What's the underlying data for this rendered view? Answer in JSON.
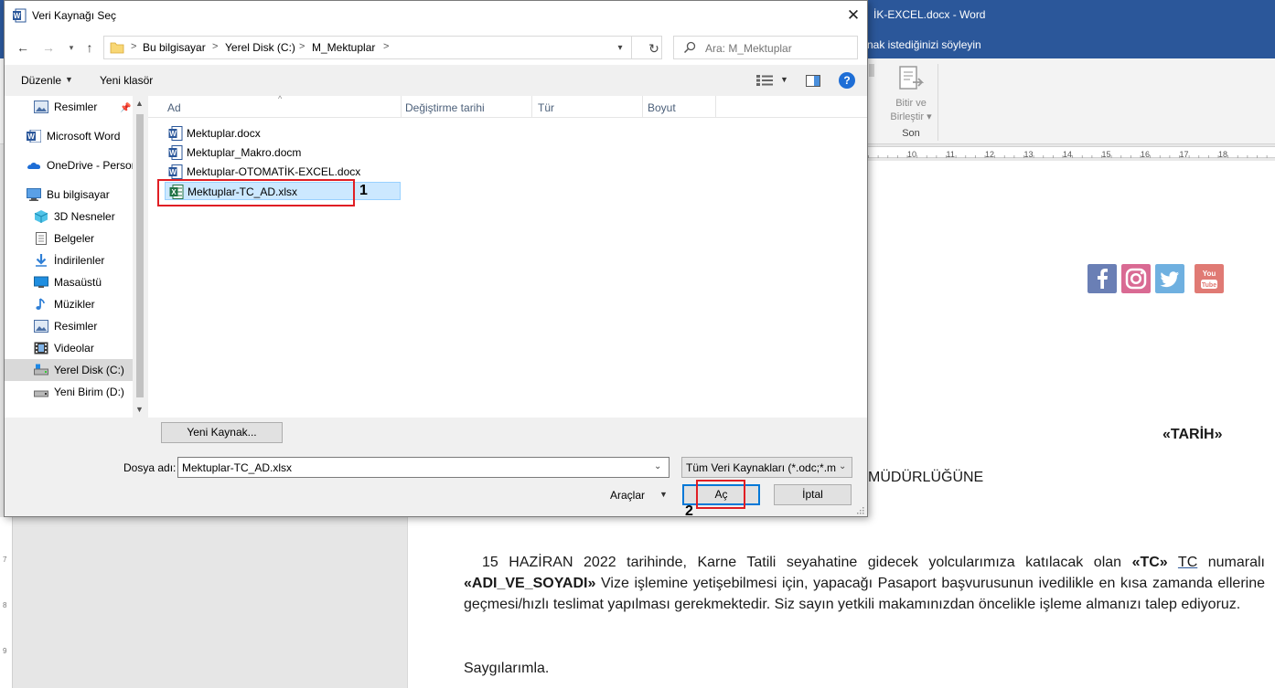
{
  "word": {
    "title": "İK-EXCEL.docx  -  Word",
    "tell_me": "nak istediğinizi söyleyin",
    "ribbon": {
      "finish_merge_label": "Bitir ve\nBirleştir ▾",
      "group_label": "Son"
    },
    "ruler_numbers": [
      "10",
      "11",
      "12",
      "13",
      "14",
      "15",
      "16",
      "17",
      "18"
    ],
    "vruler_numbers": [
      "7",
      "8",
      "9"
    ],
    "document": {
      "tarih": "«TARİH»",
      "mudurluk": "MÜDÜRLÜĞÜNE",
      "paragraph": {
        "p1": "15 HAZİRAN 2022 tarihinde, Karne Tatili seyahatine gidecek yolcularımıza katılacak olan ",
        "tc_field": "«TC»",
        "p2": " ",
        "tc_word": "TC",
        "p3": " numaralı ",
        "name_field": "«ADI_VE_SOYADI»",
        "p4": " Vize işlemine yetişebilmesi için, yapacağı Pasaport başvurusunun ivedilikle en kısa zamanda ellerine geçmesi/hızlı teslimat yapılması gerekmektedir. Siz sayın yetkili makamınızdan öncelikle işleme almanızı talep ediyoruz."
      },
      "closing": "Saygılarımla.",
      "social_icons": [
        "facebook-icon",
        "instagram-icon",
        "twitter-icon",
        "youtube-icon"
      ]
    }
  },
  "dialog": {
    "title": "Veri Kaynağı Seç",
    "close_glyph": "✕",
    "address": {
      "segments": [
        "Bu bilgisayar",
        "Yerel Disk (C:)",
        "M_Mektuplar"
      ],
      "separator": ">"
    },
    "search": {
      "placeholder": "Ara: M_Mektuplar"
    },
    "toolbar": {
      "organize": "Düzenle",
      "new_folder": "Yeni klasör",
      "help": "?"
    },
    "nav_items": [
      {
        "label": "Resimler",
        "icon": "pictures-icon"
      },
      {
        "label": "Microsoft Word",
        "icon": "word-icon"
      },
      {
        "label": "OneDrive - Person",
        "icon": "onedrive-icon"
      },
      {
        "label": "Bu bilgisayar",
        "icon": "computer-icon"
      },
      {
        "label": "3D Nesneler",
        "icon": "3d-objects-icon"
      },
      {
        "label": "Belgeler",
        "icon": "documents-icon"
      },
      {
        "label": "İndirilenler",
        "icon": "downloads-icon"
      },
      {
        "label": "Masaüstü",
        "icon": "desktop-icon"
      },
      {
        "label": "Müzikler",
        "icon": "music-icon"
      },
      {
        "label": "Resimler",
        "icon": "pictures-icon"
      },
      {
        "label": "Videolar",
        "icon": "videos-icon"
      },
      {
        "label": "Yerel Disk (C:)",
        "icon": "local-disk-icon",
        "selected": true
      },
      {
        "label": "Yeni Birim (D:)",
        "icon": "drive-icon"
      }
    ],
    "columns": [
      "Ad",
      "Değiştirme tarihi",
      "Tür",
      "Boyut"
    ],
    "files": [
      {
        "name": "Mektuplar.docx",
        "icon": "word-doc-icon"
      },
      {
        "name": "Mektuplar_Makro.docm",
        "icon": "word-doc-icon"
      },
      {
        "name": "Mektuplar-OTOMATİK-EXCEL.docx",
        "icon": "word-doc-icon"
      },
      {
        "name": "Mektuplar-TC_AD.xlsx",
        "icon": "excel-icon",
        "selected": true
      }
    ],
    "new_source_button": "Yeni Kaynak...",
    "filename_label": "Dosya adı:",
    "filename_value": "Mektuplar-TC_AD.xlsx",
    "filetype_value": "Tüm Veri Kaynakları (*.odc;*.mdb",
    "tools_label": "Araçlar",
    "open_button": "Aç",
    "cancel_button": "İptal",
    "callouts": [
      "1",
      "2"
    ],
    "colors": {
      "selection_bg": "#cce8ff",
      "highlight_red": "#e01e24",
      "accent_blue": "#0078d7",
      "word_blue": "#2b579a"
    }
  }
}
